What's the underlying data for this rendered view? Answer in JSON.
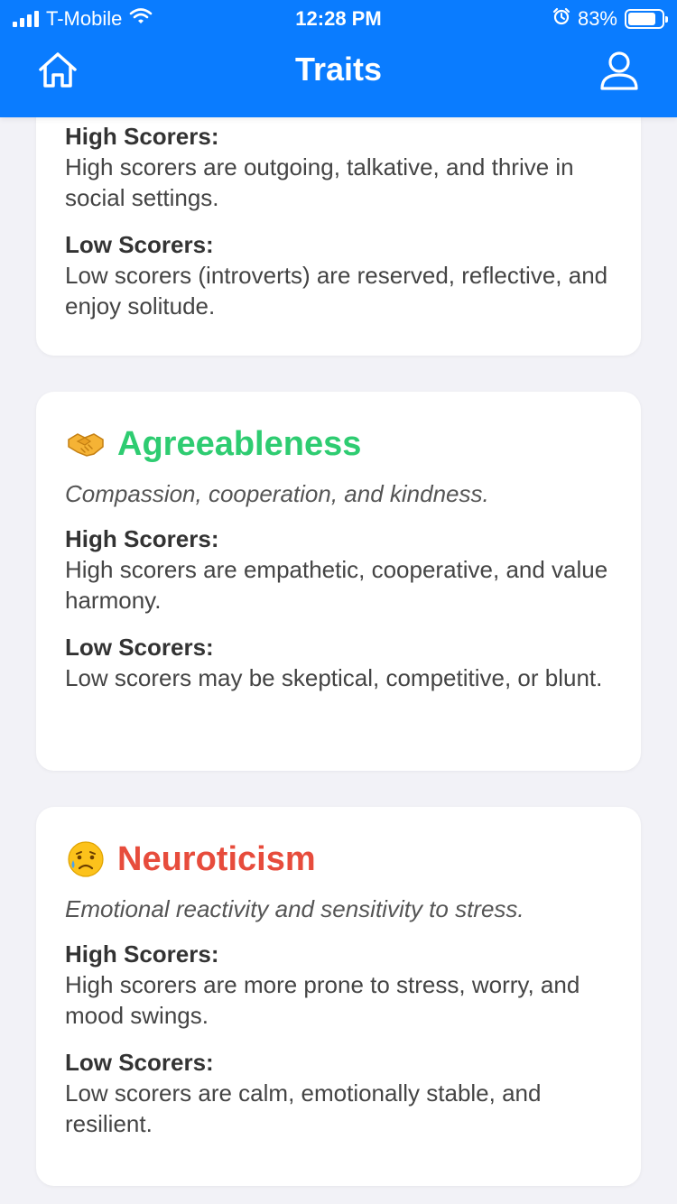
{
  "status_bar": {
    "carrier": "T-Mobile",
    "time": "12:28 PM",
    "battery_percent": "83%",
    "battery_level": 0.83,
    "icons": [
      "signal-icon",
      "wifi-icon",
      "alarm-icon",
      "battery-icon"
    ]
  },
  "nav": {
    "title": "Traits",
    "left_icon": "home-icon",
    "right_icon": "profile-icon",
    "bar_color": "#0a7cff"
  },
  "cards": [
    {
      "high_label": "High Scorers:",
      "high_text": "High scorers are outgoing, talkative, and thrive in social settings.",
      "low_label": "Low Scorers:",
      "low_text": "Low scorers (introverts) are reserved, reflective, and enjoy solitude."
    },
    {
      "emoji": "handshake-icon",
      "title": "Agreeableness",
      "title_color": "#2ecc71",
      "subtitle": "Compassion, cooperation, and kindness.",
      "high_label": "High Scorers:",
      "high_text": "High scorers are empathetic, cooperative, and value harmony.",
      "low_label": "Low Scorers:",
      "low_text": "Low scorers may be skeptical, competitive, or blunt."
    },
    {
      "emoji": "sad-relieved-face-icon",
      "title": "Neuroticism",
      "title_color": "#e74c3c",
      "subtitle": "Emotional reactivity and sensitivity to stress.",
      "high_label": "High Scorers:",
      "high_text": "High scorers are more prone to stress, worry, and mood swings.",
      "low_label": "Low Scorers:",
      "low_text": "Low scorers are calm, emotionally stable, and resilient."
    }
  ]
}
